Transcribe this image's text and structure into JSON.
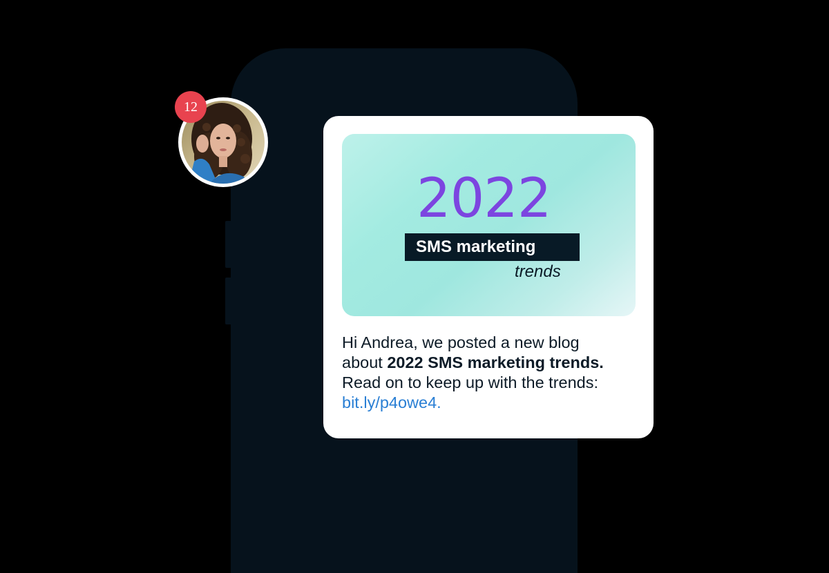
{
  "notification": {
    "badge_count": "12",
    "avatar": "user-avatar"
  },
  "banner": {
    "year": "2022",
    "headline": "SMS marketing",
    "subline": "trends"
  },
  "message": {
    "line1": "Hi Andrea, we posted a new blog",
    "line2_prefix": "about ",
    "line2_bold": "2022 SMS marketing trends.",
    "line3": "Read on to keep up with the trends:",
    "link": "bit.ly/p4owe4."
  },
  "colors": {
    "badge": "#e8434f",
    "year": "#7c45e0",
    "link": "#2a7fd4",
    "phone": "#06121c"
  }
}
